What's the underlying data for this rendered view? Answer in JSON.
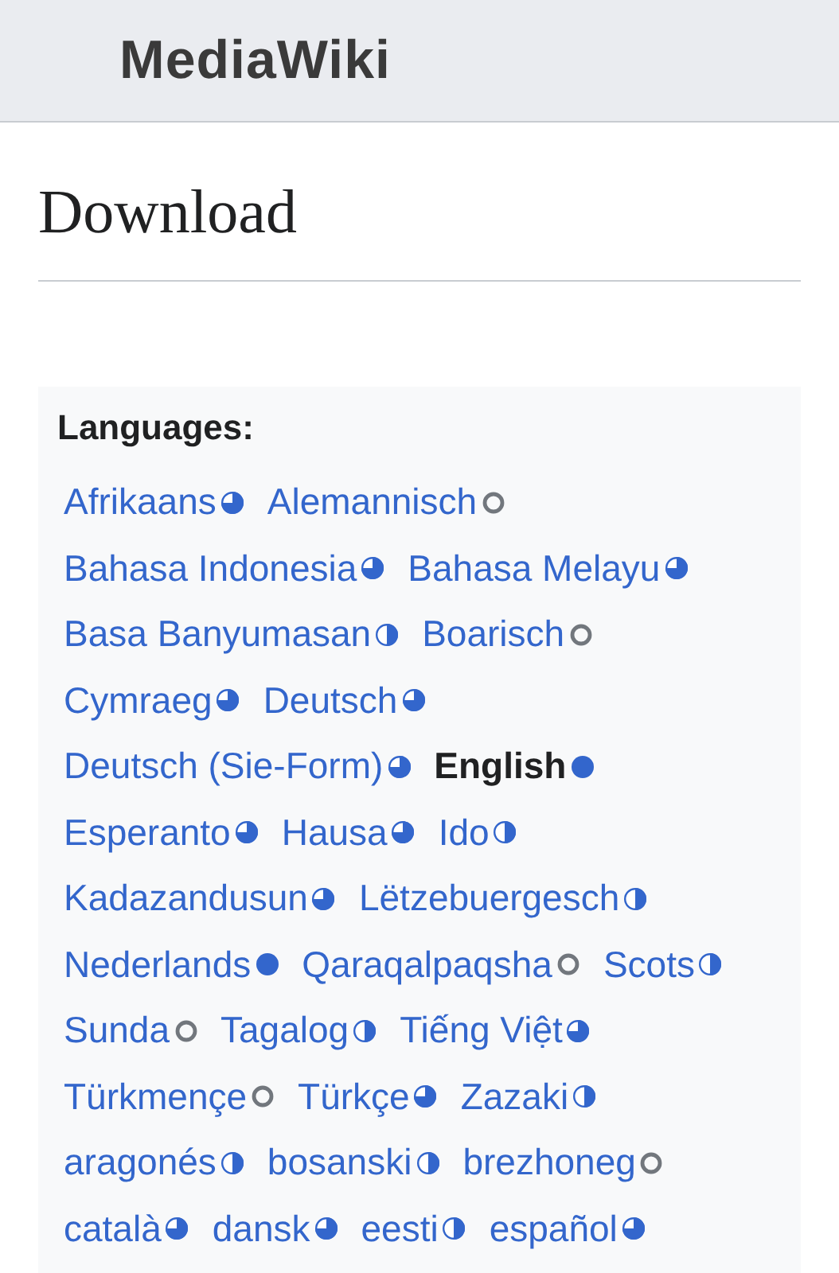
{
  "header": {
    "site_name": "MediaWiki"
  },
  "page": {
    "title": "Download"
  },
  "languages": {
    "heading": "Languages:",
    "rows": [
      [
        {
          "name": "Afrikaans",
          "kind": "most",
          "selected": false
        },
        {
          "name": "Alemannisch",
          "kind": "none",
          "selected": false
        }
      ],
      [
        {
          "name": "Bahasa Indonesia",
          "kind": "most",
          "selected": false
        },
        {
          "name": "Bahasa Melayu",
          "kind": "most",
          "selected": false
        }
      ],
      [
        {
          "name": "Basa Banyumasan",
          "kind": "half",
          "selected": false
        },
        {
          "name": "Boarisch",
          "kind": "none",
          "selected": false
        }
      ],
      [
        {
          "name": "Cymraeg",
          "kind": "most",
          "selected": false
        },
        {
          "name": "Deutsch",
          "kind": "most",
          "selected": false
        }
      ],
      [
        {
          "name": "Deutsch (Sie-Form)",
          "kind": "most",
          "selected": false
        },
        {
          "name": "English",
          "kind": "full",
          "selected": true
        }
      ],
      [
        {
          "name": "Esperanto",
          "kind": "most",
          "selected": false
        },
        {
          "name": "Hausa",
          "kind": "most",
          "selected": false
        },
        {
          "name": "Ido",
          "kind": "half",
          "selected": false
        }
      ],
      [
        {
          "name": "Kadazandusun",
          "kind": "most",
          "selected": false
        },
        {
          "name": "Lëtzebuergesch",
          "kind": "half",
          "selected": false
        }
      ],
      [
        {
          "name": "Nederlands",
          "kind": "full",
          "selected": false
        },
        {
          "name": "Qaraqalpaqsha",
          "kind": "none",
          "selected": false
        },
        {
          "name": "Scots",
          "kind": "half",
          "selected": false
        }
      ],
      [
        {
          "name": "Sunda",
          "kind": "none",
          "selected": false
        },
        {
          "name": "Tagalog",
          "kind": "half",
          "selected": false
        },
        {
          "name": "Tiếng Việt",
          "kind": "most",
          "selected": false
        }
      ],
      [
        {
          "name": "Türkmençe",
          "kind": "none",
          "selected": false
        },
        {
          "name": "Türkçe",
          "kind": "most",
          "selected": false
        },
        {
          "name": "Zazaki",
          "kind": "half",
          "selected": false
        }
      ],
      [
        {
          "name": "aragonés",
          "kind": "half",
          "selected": false
        },
        {
          "name": "bosanski",
          "kind": "half",
          "selected": false
        },
        {
          "name": "brezhoneg",
          "kind": "none",
          "selected": false
        }
      ],
      [
        {
          "name": "català",
          "kind": "most",
          "selected": false
        },
        {
          "name": "dansk",
          "kind": "most",
          "selected": false
        },
        {
          "name": "eesti",
          "kind": "half",
          "selected": false
        },
        {
          "name": "español",
          "kind": "most",
          "selected": false
        }
      ]
    ]
  }
}
